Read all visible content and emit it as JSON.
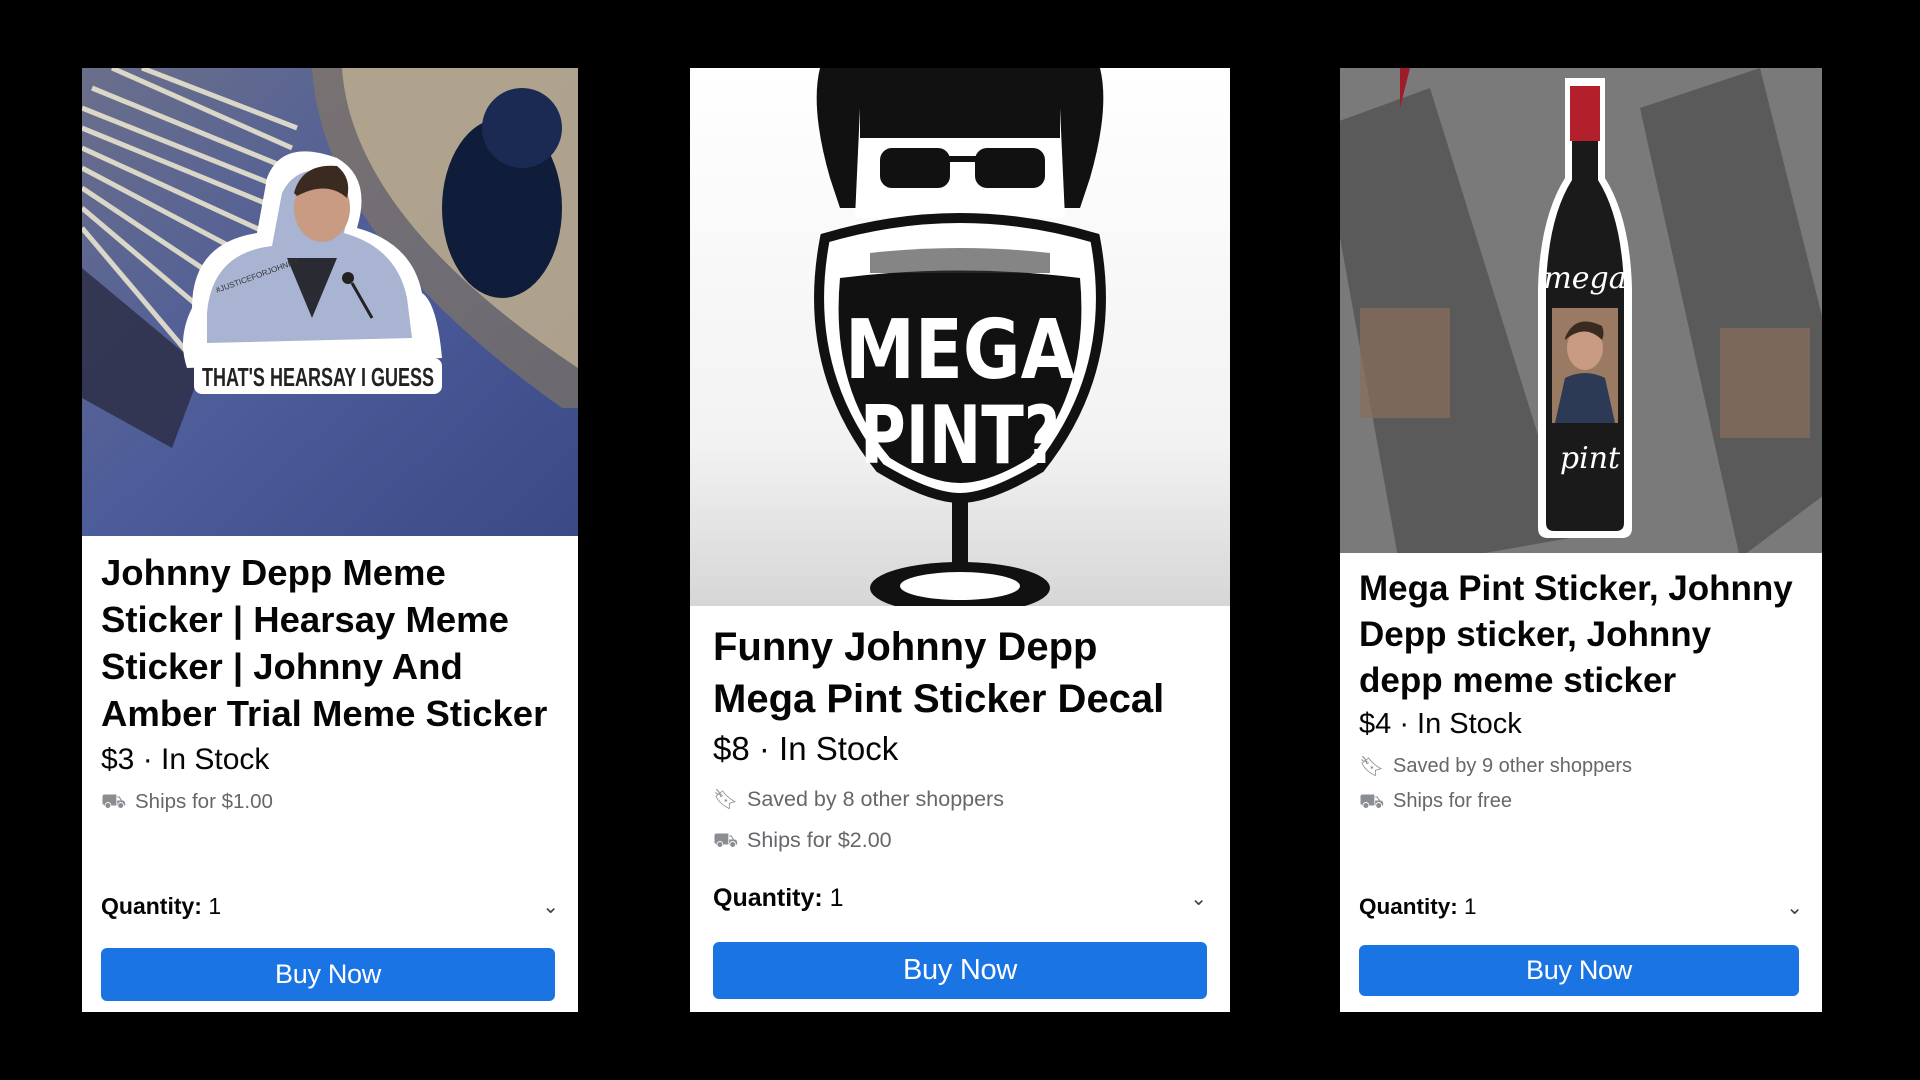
{
  "cards": [
    {
      "sticker_text": "THAT'S HEARSAY I GUESS",
      "sticker_hashtag": "#JUSTICEFORJOHNNY",
      "title": "Johnny Depp Meme Sticker | Hearsay Meme Sticker | Johnny And Amber Trial Meme Sticker",
      "price_stock": "$3 · In Stock",
      "shipping": "Ships for $1.00",
      "quantity_label": "Quantity:",
      "quantity_value": "1",
      "buy_label": "Buy Now"
    },
    {
      "sticker_text_line1": "MEGA",
      "sticker_text_line2": "PINT?",
      "title": "Funny Johnny Depp Mega Pint Sticker Decal",
      "price_stock": "$8 · In Stock",
      "saved": "Saved by 8 other shoppers",
      "shipping": "Ships for $2.00",
      "quantity_label": "Quantity:",
      "quantity_value": "1",
      "buy_label": "Buy Now"
    },
    {
      "bottle_label_top": "mega",
      "bottle_label_bottom": "pint",
      "title": "Mega Pint Sticker, Johnny Depp sticker, Johnny depp meme sticker",
      "price_stock": "$4 · In Stock",
      "saved": "Saved by 9 other shoppers",
      "shipping": "Ships for free",
      "quantity_label": "Quantity:",
      "quantity_value": "1",
      "buy_label": "Buy Now"
    }
  ],
  "icons": {
    "bookmark": "bookmark-icon",
    "truck": "truck-icon",
    "chevron": "chevron-down-icon"
  },
  "colors": {
    "buy_button": "#1b74e4",
    "background": "#000000"
  }
}
